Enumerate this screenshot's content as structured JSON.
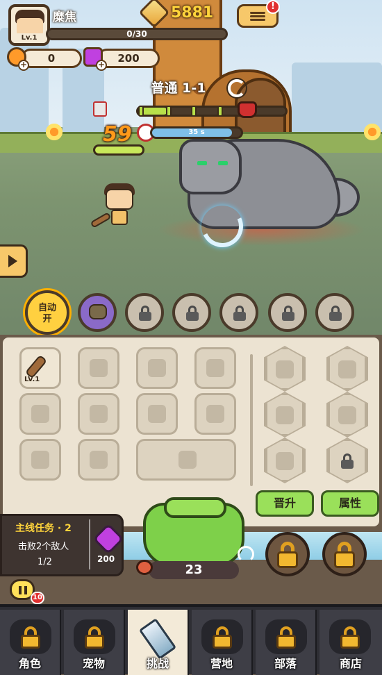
{
  "player": {
    "name": "糜焦",
    "level_label": "Lv.1",
    "xp_text": "0/30"
  },
  "currency": {
    "gold": "5881",
    "orange_resource": "0",
    "purple_gems": "200"
  },
  "stage": {
    "title": "普通 1-1",
    "wave_progress": 0.2,
    "player_level": "59",
    "player_hp": 1.0,
    "timer_text": "35 s",
    "timer_fill": 0.9
  },
  "skills": {
    "auto_label": "自动\n开"
  },
  "equipment": {
    "weapon_level": "LV.1",
    "upgrade_button": "晋升",
    "attributes_button": "属性"
  },
  "quest": {
    "title": "主线任务 · 2",
    "description": "击败2个敌人",
    "progress": "1/2",
    "reward_amount": "200"
  },
  "pet": {
    "food_count": "23"
  },
  "chat": {
    "unread": "10"
  },
  "nav": {
    "items": [
      {
        "label": "角色",
        "locked": true
      },
      {
        "label": "宠物",
        "locked": true
      },
      {
        "label": "挑战",
        "locked": false
      },
      {
        "label": "营地",
        "locked": true
      },
      {
        "label": "部落",
        "locked": true
      },
      {
        "label": "商店",
        "locked": true
      }
    ]
  },
  "colors": {
    "gold_text": "#ffd43b",
    "accent_green": "#9ae05a",
    "hp_red": "#d03030"
  }
}
